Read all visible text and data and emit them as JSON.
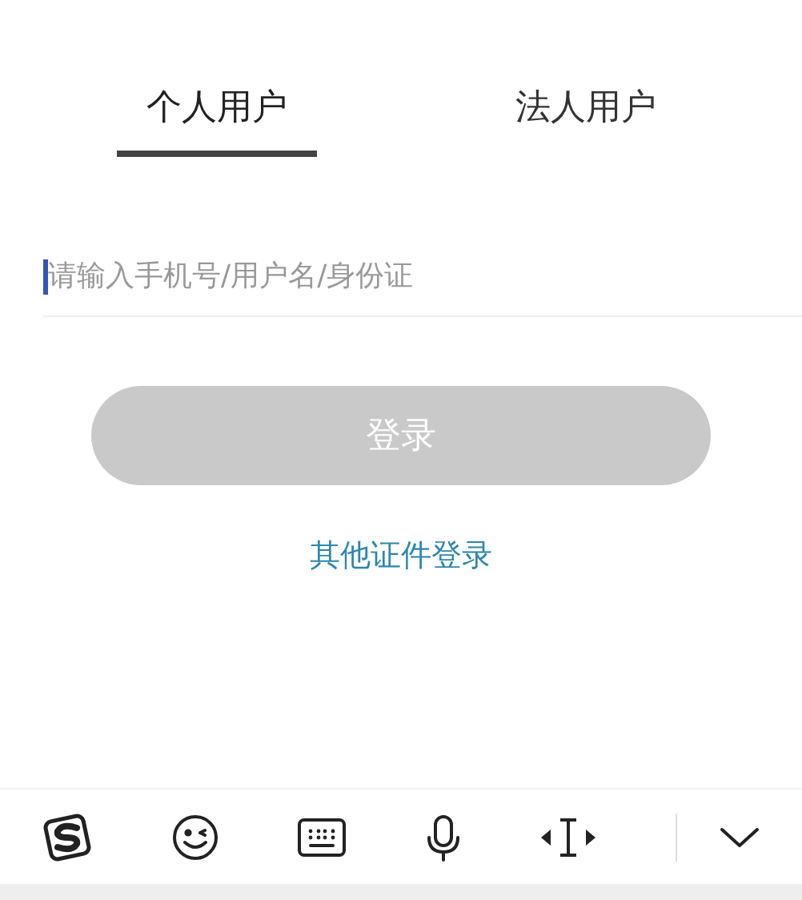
{
  "tabs": [
    {
      "label": "个人用户",
      "selected": true
    },
    {
      "label": "法人用户",
      "selected": false
    }
  ],
  "login_field": {
    "placeholder": "请输入手机号/用户名/身份证",
    "focused": true
  },
  "login_button": {
    "label": "登录",
    "disabled": true
  },
  "alt_login_link": "其他证件登录",
  "keyboard_toolbar": [
    {
      "kind": "logo"
    },
    {
      "kind": "emoji"
    },
    {
      "kind": "keyboard"
    },
    {
      "kind": "mic"
    },
    {
      "kind": "cursor"
    },
    {
      "kind": "collapse"
    }
  ]
}
